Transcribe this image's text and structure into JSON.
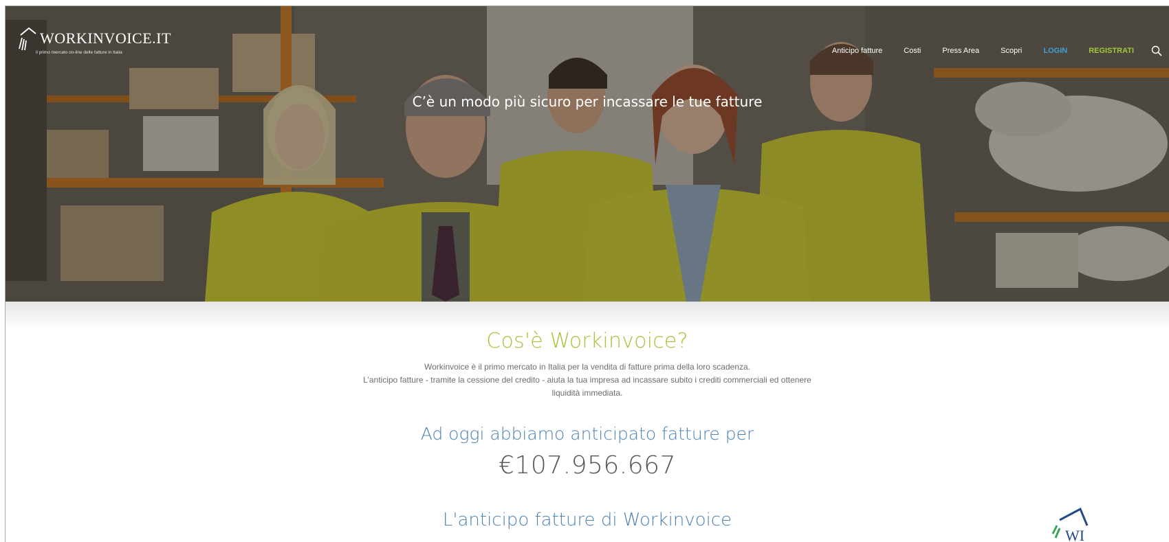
{
  "brand": {
    "name": "WORKINVOICE.IT",
    "tagline": "il primo mercato on-line delle fatture in Italia",
    "logo_icon": "book-logo-icon"
  },
  "nav": {
    "items": [
      {
        "label": "Anticipo fatture"
      },
      {
        "label": "Costi"
      },
      {
        "label": "Press Area"
      },
      {
        "label": "Scopri"
      }
    ],
    "login_label": "LOGIN",
    "register_label": "REGISTRATI",
    "search_icon": "search-icon"
  },
  "hero": {
    "headline": "C’è un modo più sicuro per incassare le tue fatture"
  },
  "about": {
    "title": "Cos'è Workinvoice?",
    "line1": "Workinvoice è il primo mercato in Italia per la vendita di fatture prima della loro scadenza.",
    "line2": "L’anticipo fatture - tramite la cessione del credito - aiuta la tua impresa ad incassare subito i crediti commerciali ed ottenere liquidità immediata."
  },
  "counter": {
    "label": "Ad oggi abbiamo anticipato fatture per",
    "value": "€107.956.667"
  },
  "subsection": {
    "title": "L'anticipo fatture di Workinvoice",
    "badge_icon": "wi-logo-icon",
    "badge_text": "WI"
  },
  "colors": {
    "accent_green": "#a4c43a",
    "accent_blue": "#4c82b5",
    "login_blue": "#3ea1d8",
    "register_green": "#a6c63a"
  }
}
